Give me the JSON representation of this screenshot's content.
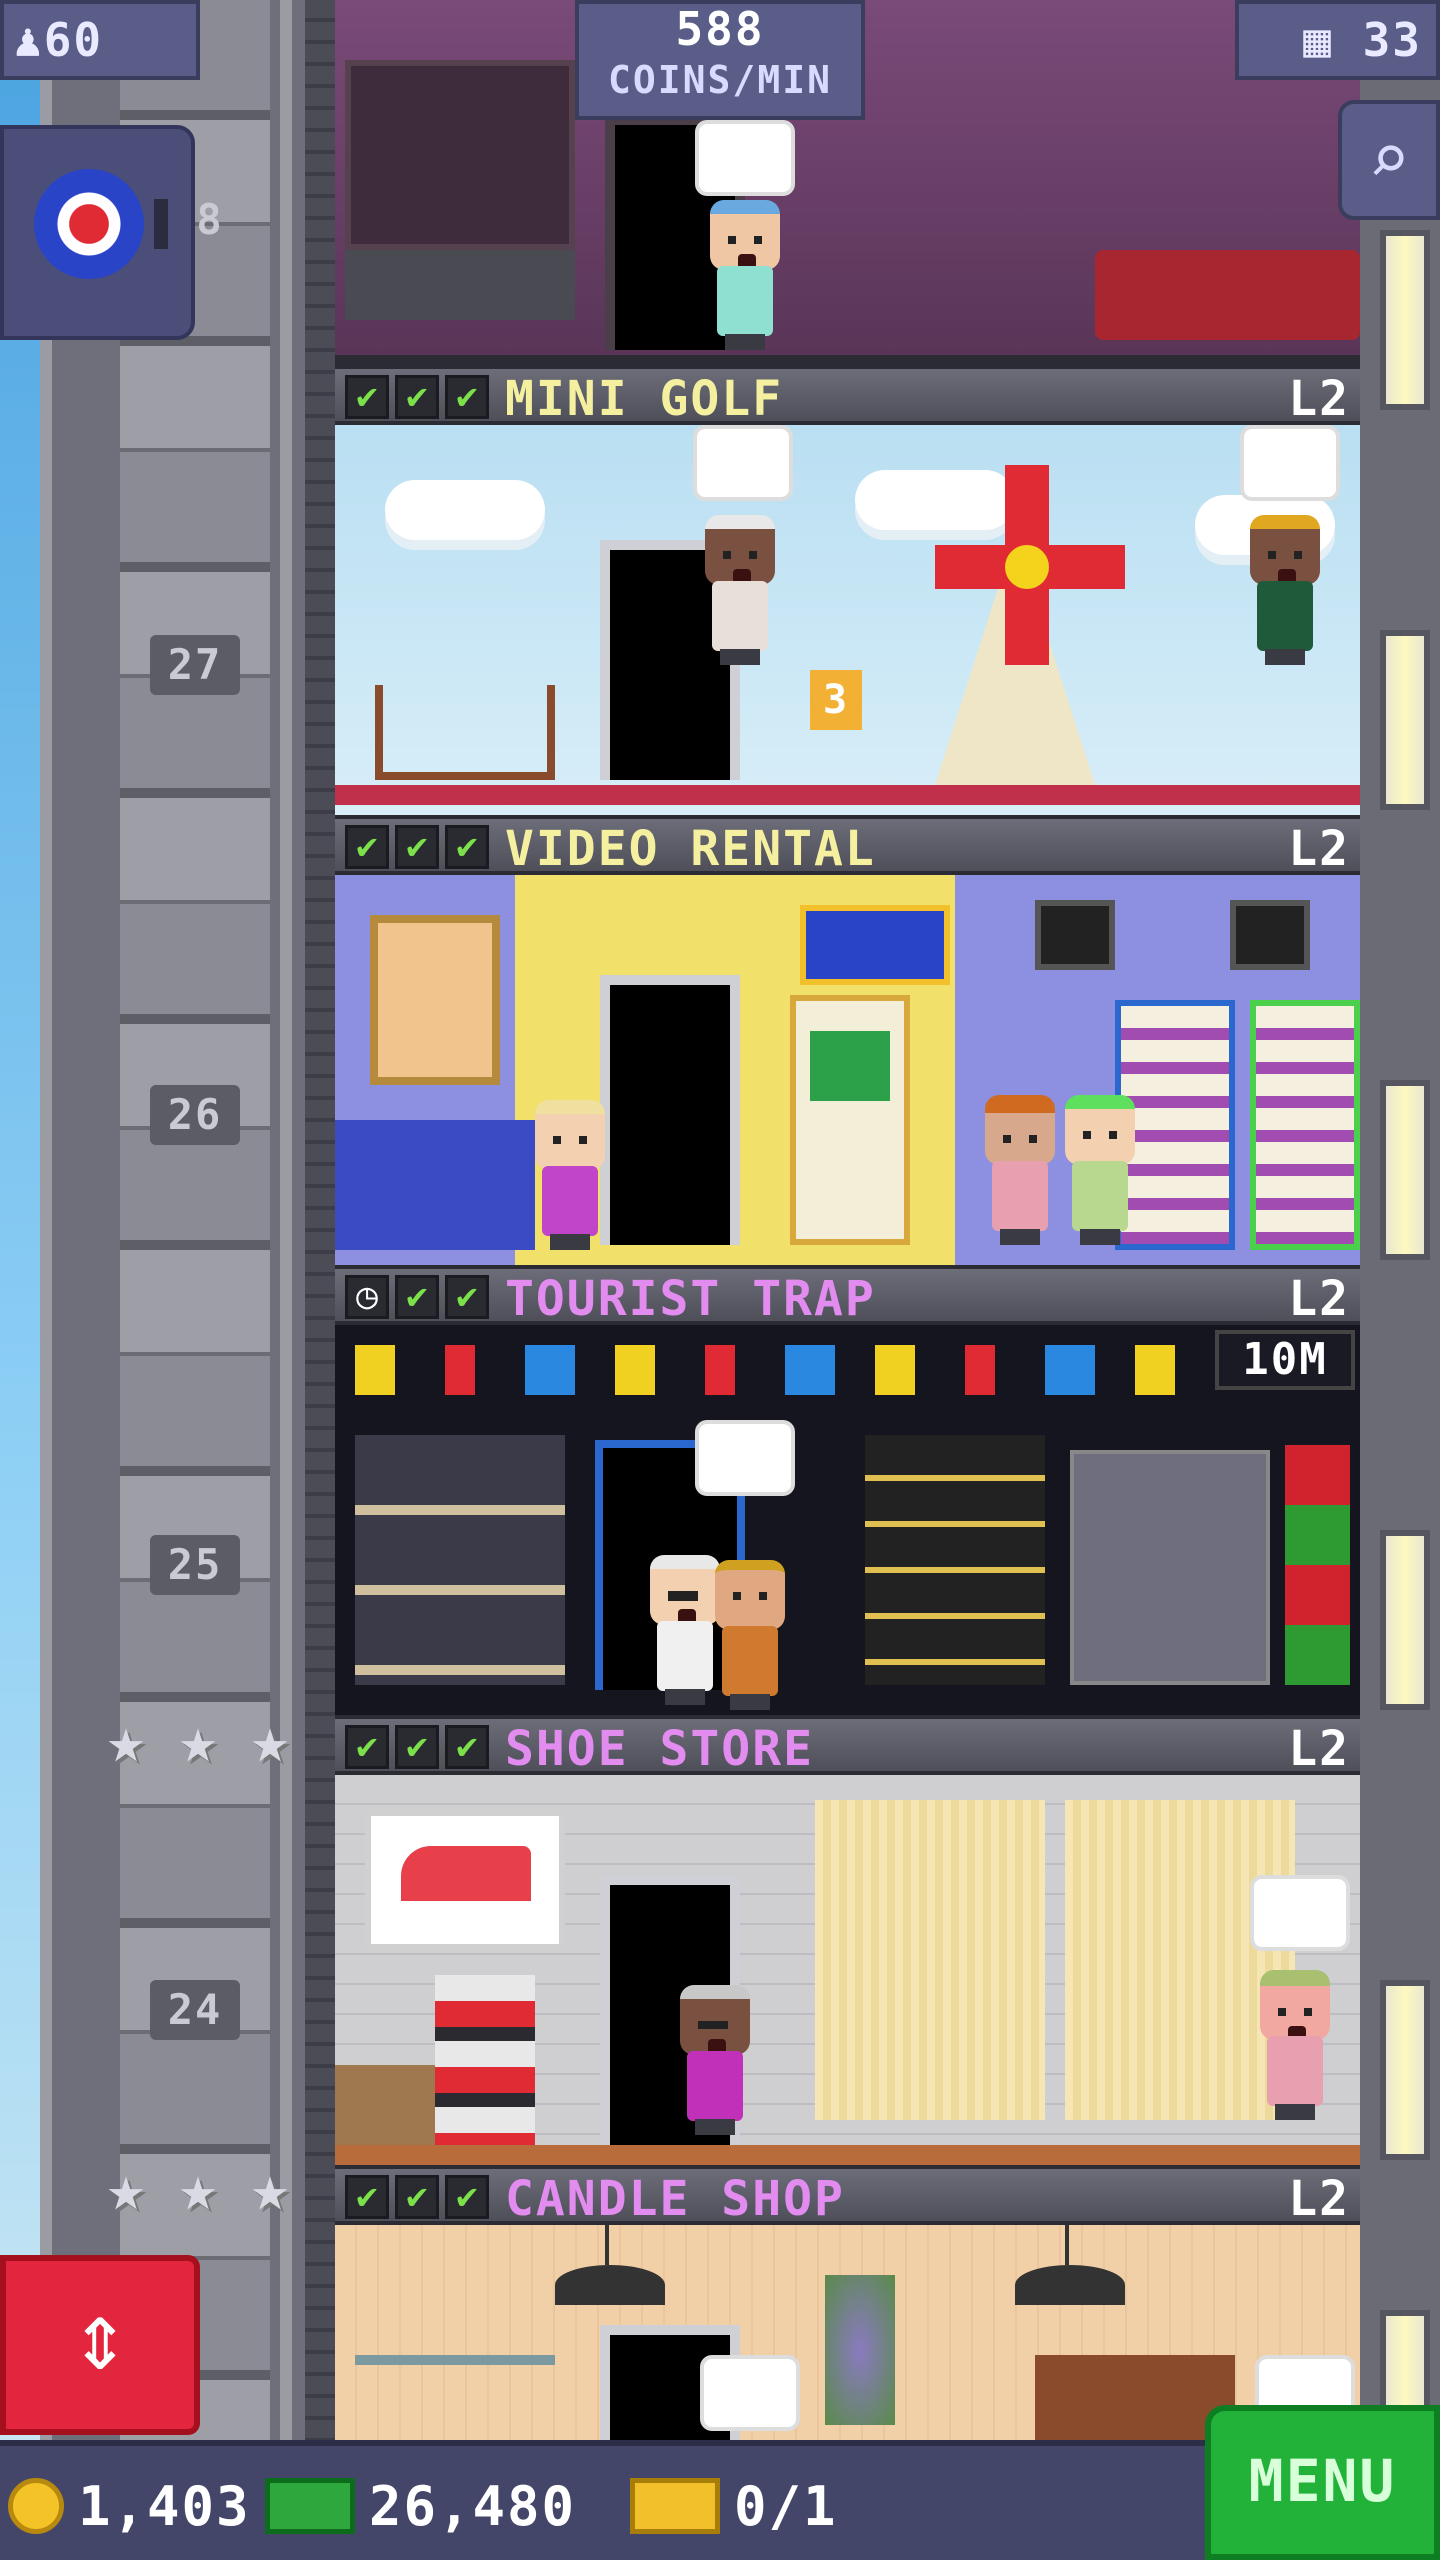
{
  "hud": {
    "population": "60",
    "coins_per_min_value": "588",
    "coins_per_min_label": "COINS/MIN",
    "floor_count": "33"
  },
  "floor_numbers": [
    "8",
    "27",
    "26",
    "25",
    "24"
  ],
  "floors": [
    {
      "name": "MINI GOLF",
      "level": "L2",
      "name_color": "#f5f0a0",
      "checks": [
        "check",
        "check",
        "check"
      ],
      "bubble_note": "3"
    },
    {
      "name": "VIDEO RENTAL",
      "level": "L2",
      "name_color": "#f5f0a0",
      "checks": [
        "check",
        "check",
        "check"
      ]
    },
    {
      "name": "TOURIST TRAP",
      "level": "L2",
      "name_color": "#e28cf0",
      "checks": [
        "clock",
        "check",
        "check"
      ],
      "timer": "10M"
    },
    {
      "name": "SHOE STORE",
      "level": "L2",
      "name_color": "#e28cf0",
      "checks": [
        "check",
        "check",
        "check"
      ]
    },
    {
      "name": "CANDLE SHOP",
      "level": "L2",
      "name_color": "#e28cf0",
      "checks": [
        "check",
        "check",
        "check"
      ]
    }
  ],
  "check_symbol": "✔",
  "clock_symbol": "◷",
  "icons": {
    "population": "person-icon",
    "floors": "building-icon",
    "zoom": "magnifier-icon",
    "elevator": "elevator-arrows-icon",
    "star": "star-icon"
  },
  "bottom_bar": {
    "coins": "1,403",
    "bux": "26,480",
    "tickets": "0/1",
    "menu_label": "MENU"
  },
  "colors": {
    "check_green": "#7be04a",
    "hud_bg": "#5a5d88",
    "menu_green": "#22b23a",
    "elevator_red": "#e3263e"
  }
}
